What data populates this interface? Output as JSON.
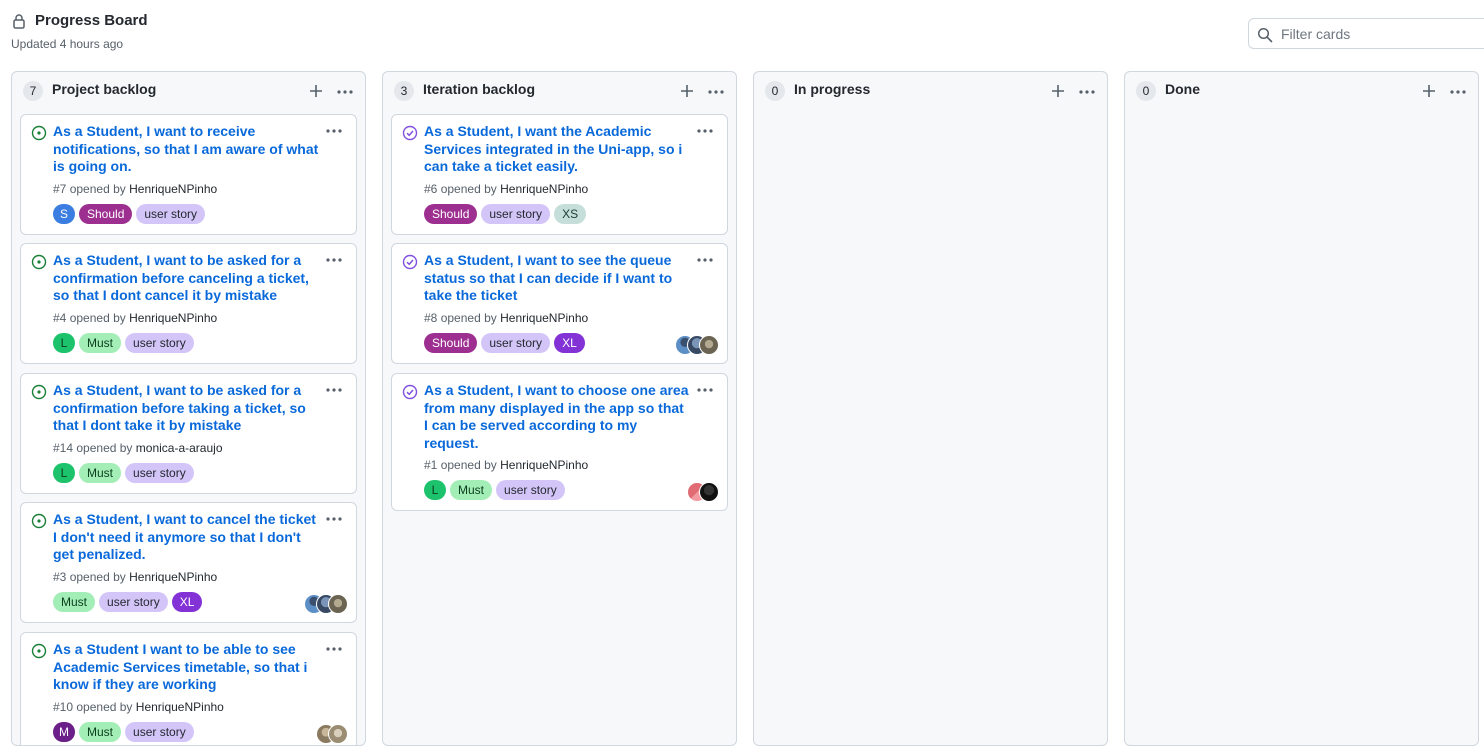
{
  "board": {
    "title": "Progress Board",
    "updated": "Updated 4 hours ago",
    "filter_placeholder": "Filter cards"
  },
  "colors": {
    "link": "#0969da",
    "open": "#1a7f37",
    "closed": "#8250df",
    "label_S": "#3b7de0",
    "label_Should": "#9c2f8f",
    "label_user_story": "#d4c5f9",
    "label_L": "#1dc36c",
    "label_Must": "#a2eeb6",
    "label_XL": "#8332d6",
    "label_M": "#6a1f89",
    "label_XS": "#c5ded9"
  },
  "columns": [
    {
      "count": "7",
      "name": "Project backlog",
      "cards": [
        {
          "title": "As a Student, I want to receive notifications, so that I am aware of what is going on.",
          "number": "#7",
          "opened_by": "opened by",
          "user": "HenriqueNPinho",
          "status": "open",
          "labels": [
            "S",
            "Should",
            "user story"
          ],
          "avatars": []
        },
        {
          "title": "As a Student, I want to be asked for a confirmation before canceling a ticket, so that I dont cancel it by mistake",
          "number": "#4",
          "opened_by": "opened by",
          "user": "HenriqueNPinho",
          "status": "open",
          "labels": [
            "L",
            "Must",
            "user story"
          ],
          "avatars": []
        },
        {
          "title": "As a Student, I want to be asked for a confirmation before taking a ticket, so that I dont take it by mistake",
          "number": "#14",
          "opened_by": "opened by",
          "user": "monica-a-araujo",
          "status": "open",
          "labels": [
            "L",
            "Must",
            "user story"
          ],
          "avatars": []
        },
        {
          "title": "As a Student, I want to cancel the ticket I don't need it anymore so that I don't get penalized.",
          "number": "#3",
          "opened_by": "opened by",
          "user": "HenriqueNPinho",
          "status": "open",
          "labels": [
            "Must",
            "user story",
            "XL"
          ],
          "avatars": [
            "avatar-1",
            "avatar-2",
            "avatar-3"
          ]
        },
        {
          "title": "As a Student I want to be able to see Academic Services timetable, so that i know if they are working",
          "number": "#10",
          "opened_by": "opened by",
          "user": "HenriqueNPinho",
          "status": "open",
          "labels": [
            "M",
            "Must",
            "user story"
          ],
          "avatars": [
            "avatar-4",
            "avatar-5"
          ]
        }
      ]
    },
    {
      "count": "3",
      "name": "Iteration backlog",
      "cards": [
        {
          "title": "As a Student, I want the Academic Services integrated in the Uni-app, so i can take a ticket easily.",
          "number": "#6",
          "opened_by": "opened by",
          "user": "HenriqueNPinho",
          "status": "closed",
          "labels": [
            "Should",
            "user story",
            "XS"
          ],
          "avatars": []
        },
        {
          "title": "As a Student, I want to see the queue status so that I can decide if I want to take the ticket",
          "number": "#8",
          "opened_by": "opened by",
          "user": "HenriqueNPinho",
          "status": "closed",
          "labels": [
            "Should",
            "user story",
            "XL"
          ],
          "avatars": [
            "avatar-1",
            "avatar-2",
            "avatar-3"
          ]
        },
        {
          "title": "As a Student, I want to choose one area from many displayed in the app so that I can be served according to my request.",
          "number": "#1",
          "opened_by": "opened by",
          "user": "HenriqueNPinho",
          "status": "closed",
          "labels": [
            "L",
            "Must",
            "user story"
          ],
          "avatars": [
            "avatar-6",
            "avatar-7"
          ]
        }
      ]
    },
    {
      "count": "0",
      "name": "In progress",
      "cards": []
    },
    {
      "count": "0",
      "name": "Done",
      "cards": []
    }
  ]
}
